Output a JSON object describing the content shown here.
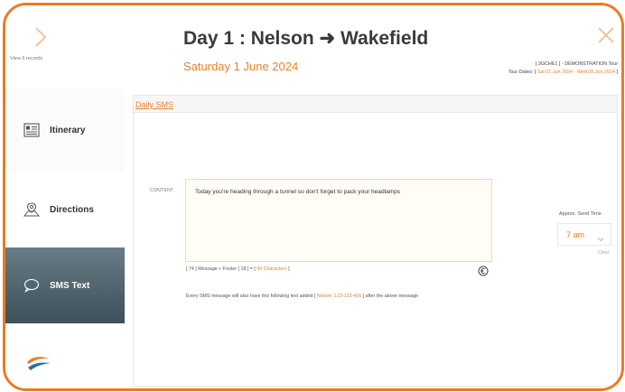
{
  "header": {
    "view_records": "View 6 records",
    "title": "Day 1 : Nelson ➜ Wakefield",
    "subtitle": "Saturday 1 June 2024",
    "tour_code": "[ 3GCHE1 ] - DEMONSTRATION Tour",
    "tour_dates_label": "Tour Dates: [",
    "tour_dates_value": "Sat 01 Jun 2024 - Wed 05 Jun 2024",
    "tour_dates_end": "]"
  },
  "sidebar": {
    "items": [
      {
        "label": "Itinerary",
        "icon": "itinerary-icon"
      },
      {
        "label": "Directions",
        "icon": "map-icon"
      },
      {
        "label": "SMS Text",
        "icon": "chat-bubble-icon"
      }
    ]
  },
  "panel": {
    "tab_label": "Daily SMS",
    "content_label": "CONTENT",
    "message": "Today you're heading through a tunnel so don't forget to pack your headlamps",
    "counter_prefix": "[ 74 ] Message + Footer [ 18 ] = [",
    "counter_value": "94 Characters",
    "counter_suffix": "]",
    "footer_prefix": "Every SMS message will also have this following text added [",
    "footer_value": "Nelson: 123-123-456",
    "footer_suffix": "] after the above message",
    "send_time_label": "Approx. Send Time",
    "send_time_value": "7 am",
    "clear_label": "Clear"
  },
  "colors": {
    "accent": "#ec7a22",
    "sidebar_active_top": "#687c86",
    "sidebar_active_bottom": "#3e505a"
  }
}
